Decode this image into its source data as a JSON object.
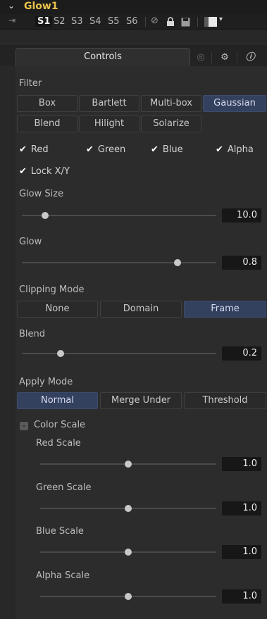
{
  "tool": {
    "name": "Glow1"
  },
  "slots": [
    "S1",
    "S2",
    "S3",
    "S4",
    "S5",
    "S6"
  ],
  "tabs": {
    "controls": "Controls"
  },
  "filter": {
    "label": "Filter",
    "options": [
      "Box",
      "Bartlett",
      "Multi-box",
      "Gaussian",
      "Blend",
      "Hilight",
      "Solarize"
    ],
    "selected": "Gaussian"
  },
  "channels": {
    "red": "Red",
    "green": "Green",
    "blue": "Blue",
    "alpha": "Alpha",
    "lock": "Lock X/Y"
  },
  "glow_size": {
    "label": "Glow Size",
    "value": "10.0",
    "level": 0.12
  },
  "glow": {
    "label": "Glow",
    "value": "0.8",
    "level": 0.8
  },
  "clipping": {
    "label": "Clipping Mode",
    "options": [
      "None",
      "Domain",
      "Frame"
    ],
    "selected": "Frame"
  },
  "blend": {
    "label": "Blend",
    "value": "0.2",
    "level": 0.2
  },
  "apply": {
    "label": "Apply Mode",
    "options": [
      "Normal",
      "Merge Under",
      "Threshold"
    ],
    "selected": "Normal"
  },
  "color_scale": {
    "label": "Color Scale",
    "red": {
      "label": "Red Scale",
      "value": "1.0",
      "level": 0.5
    },
    "green": {
      "label": "Green Scale",
      "value": "1.0",
      "level": 0.5
    },
    "blue": {
      "label": "Blue Scale",
      "value": "1.0",
      "level": 0.5
    },
    "alpha": {
      "label": "Alpha Scale",
      "value": "1.0",
      "level": 0.5
    }
  },
  "colors": {
    "title": "#e8c24a",
    "selected_button": "#33405e"
  },
  "icons": [
    "collapse-chevron-icon",
    "pin-icon",
    "disable-icon",
    "lock-icon",
    "save-icon",
    "color-swatch-icon",
    "dropdown-arrow-icon",
    "spline-icon",
    "settings-gear-icon",
    "info-icon"
  ]
}
